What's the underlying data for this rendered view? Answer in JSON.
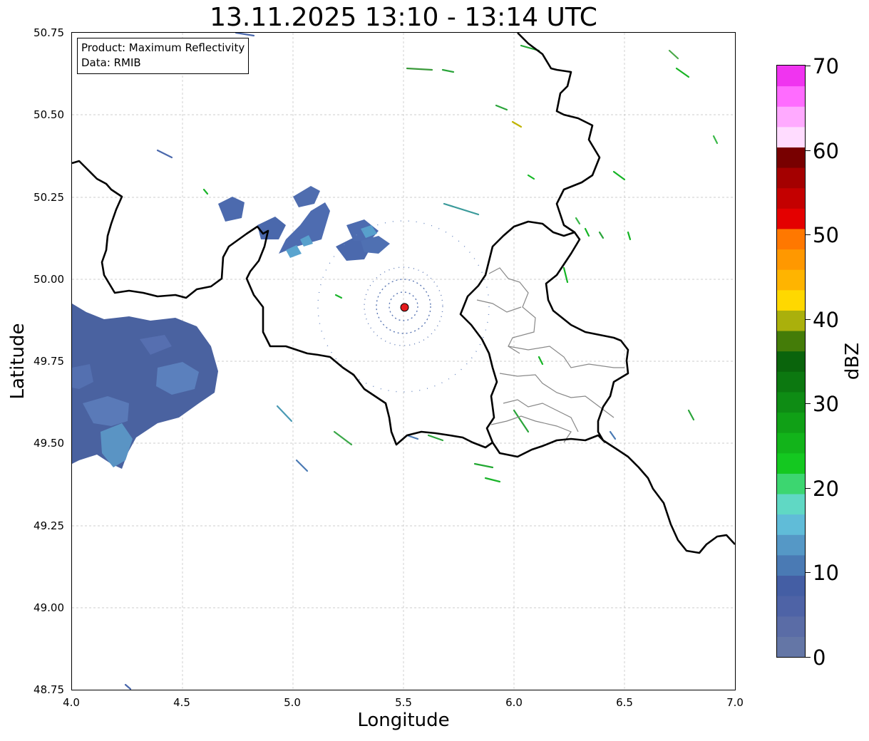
{
  "title": "13.11.2025 13:10 - 13:14 UTC",
  "info": {
    "line1": "Product: Maximum Reflectivity",
    "line2": "Data: RMIB"
  },
  "axes": {
    "xlabel": "Longitude",
    "ylabel": "Latitude",
    "xlim": [
      4.0,
      7.0
    ],
    "ylim": [
      48.75,
      50.75
    ],
    "xticks": [
      "4.0",
      "4.5",
      "5.0",
      "5.5",
      "6.0",
      "6.5",
      "7.0"
    ],
    "yticks": [
      "50.75",
      "50.50",
      "50.25",
      "50.00",
      "49.75",
      "49.50",
      "49.25",
      "49.00",
      "48.75"
    ],
    "grid": true
  },
  "colorbar": {
    "label": "dBZ",
    "min": 0,
    "max": 70,
    "ticks": [
      "0",
      "10",
      "20",
      "30",
      "40",
      "50",
      "60",
      "70"
    ],
    "colors": [
      "#6476a6",
      "#5a6ca6",
      "#4e63a6",
      "#445ea4",
      "#4a7ab4",
      "#5598c6",
      "#60bcd8",
      "#60d8c4",
      "#3cd670",
      "#14c820",
      "#12b41a",
      "#10a016",
      "#0e8c14",
      "#0c7810",
      "#0a640c",
      "#447c08",
      "#aab00c",
      "#ffd800",
      "#ffb400",
      "#ff9800",
      "#ff7800",
      "#e40000",
      "#c40000",
      "#a40000",
      "#780000",
      "#ffdcff",
      "#ffaaff",
      "#ff6cff",
      "#f034f0"
    ]
  },
  "radar_site": {
    "lon": 5.505,
    "lat": 49.914,
    "color": "#e41a1c"
  }
}
